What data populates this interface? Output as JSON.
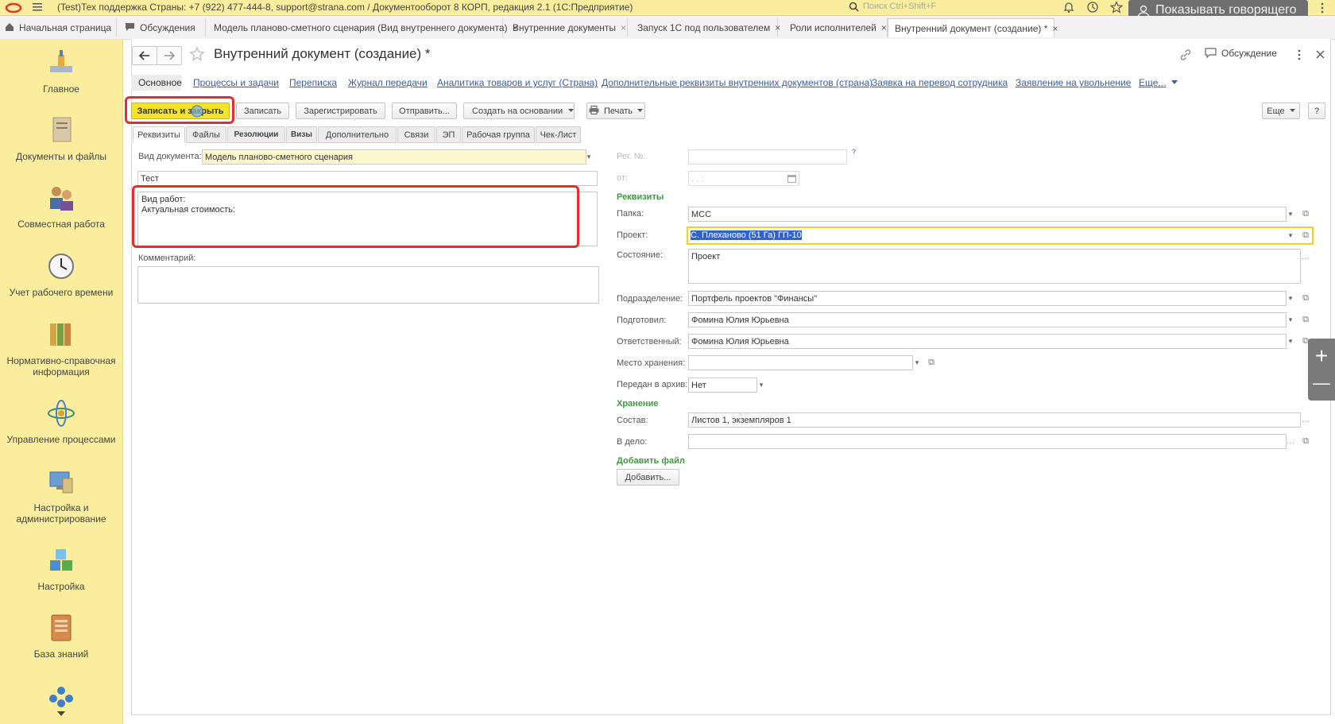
{
  "topbar": {
    "title": "(Test)Тех поддержка Страны: +7 (922) 477-444-8, support@strana.com / Документооборот 8 КОРП, редакция 2.1  (1С:Предприятие)",
    "search_placeholder": "Поиск Ctrl+Shift+F",
    "speaker_label": "Показывать говорящего"
  },
  "open_tabs": [
    {
      "label": "Начальная страница"
    },
    {
      "label": "Обсуждения"
    },
    {
      "label": "Модель планово-сметного сценария (Вид внутреннего документа)"
    },
    {
      "label": "Внутренние документы"
    },
    {
      "label": "Запуск 1С под пользователем"
    },
    {
      "label": "Роли исполнителей"
    },
    {
      "label": "Внутренний документ (создание) *"
    }
  ],
  "tab_close": "×",
  "sidebar": {
    "items": [
      {
        "label": "Главное",
        "icon": "home-icon"
      },
      {
        "label": "Документы и файлы",
        "icon": "documents-icon"
      },
      {
        "label": "Совместная работа",
        "icon": "collaboration-icon"
      },
      {
        "label": "Учет рабочего времени",
        "icon": "clock-icon"
      },
      {
        "label": "Нормативно-справочная информация",
        "icon": "reference-books-icon"
      },
      {
        "label": "Управление процессами",
        "icon": "processes-icon"
      },
      {
        "label": "Настройка и администрирование",
        "icon": "admin-icon"
      },
      {
        "label": "Настройка",
        "icon": "settings-cubes-icon"
      },
      {
        "label": "База знаний",
        "icon": "knowledge-base-icon"
      }
    ]
  },
  "doc": {
    "title": "Внутренний документ (создание) *",
    "discussion_label": "Обсуждение",
    "nav_links": [
      "Основное",
      "Процессы и задачи",
      "Переписка",
      "Журнал передачи",
      "Аналитика товаров и услуг (Страна)",
      "Дополнительные реквизиты внутренних документов (страна)",
      "Заявка на перевод сотрудника",
      "Заявление на увольнение",
      "Еще..."
    ]
  },
  "toolbar": {
    "save_close": "Записать и закрыть",
    "save": "Записать",
    "register": "Зарегистрировать",
    "send": "Отправить...",
    "create_based": "Создать на основании",
    "print": "Печать",
    "more": "Еще",
    "help": "?"
  },
  "inner_tabs": [
    "Реквизиты",
    "Файлы",
    "Резолюции",
    "Визы",
    "Дополнительно",
    "Связи",
    "ЭП",
    "Рабочая группа",
    "Чек-Лист"
  ],
  "form": {
    "doc_type_label": "Вид документа:",
    "doc_type_value": "Модель планово-сметного сценария",
    "name_value": "Тест",
    "content_line1": "Вид работ:",
    "content_line2": "Актуальная стоимость:",
    "comment_label": "Комментарий:",
    "reg_no_label": "Рег. №:",
    "reg_no_help": "?",
    "date_label": "от:",
    "date_value": ". .    :",
    "section_requisites": "Реквизиты",
    "folder_label": "Папка:",
    "folder_value": "МСС",
    "project_label": "Проект:",
    "project_value": "С. Плеханово (51 Га) ГП-10",
    "state_label": "Состояние:",
    "state_value": "Проект",
    "department_label": "Подразделение:",
    "department_value": "Портфель проектов \"Финансы\"",
    "prepared_label": "Подготовил:",
    "prepared_value": "Фомина Юлия Юрьевна",
    "responsible_label": "Ответственный:",
    "responsible_value": "Фомина Юлия Юрьевна",
    "storage_place_label": "Место хранения:",
    "storage_place_value": "",
    "archive_label": "Передан в архив:",
    "archive_value": "Нет",
    "section_storage": "Хранение",
    "composition_label": "Состав:",
    "composition_value": "Листов 1, экземпляров 1",
    "case_label": "В дело:",
    "case_value": "",
    "section_add_file": "Добавить файл",
    "add_button": "Добавить..."
  },
  "zoom": {
    "plus": "+",
    "minus": "—"
  }
}
